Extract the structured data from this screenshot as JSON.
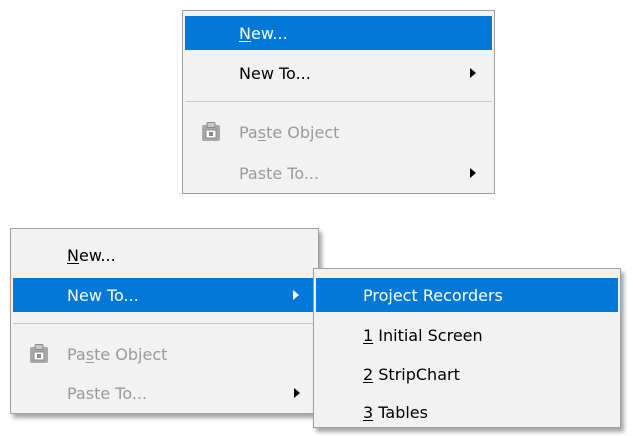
{
  "top_menu": {
    "items": [
      {
        "pre": "",
        "ul": "N",
        "post": "ew..."
      },
      {
        "pre": "New To...",
        "ul": "",
        "post": ""
      },
      {
        "pre": "Pa",
        "ul": "s",
        "post": "te Object"
      },
      {
        "pre": "Paste To...",
        "ul": "",
        "post": ""
      }
    ],
    "icons": {
      "paste": "clipboard-icon"
    }
  },
  "bottom_menu": {
    "items": [
      {
        "pre": "",
        "ul": "N",
        "post": "ew..."
      },
      {
        "pre": "New To...",
        "ul": "",
        "post": ""
      },
      {
        "pre": "Pa",
        "ul": "s",
        "post": "te Object"
      },
      {
        "pre": "Paste To...",
        "ul": "",
        "post": ""
      }
    ]
  },
  "submenu": {
    "items": [
      {
        "pre": "Project Recorders",
        "ul": "",
        "post": ""
      },
      {
        "pre": "",
        "ul": "1",
        "post": " Initial Screen"
      },
      {
        "pre": "",
        "ul": "2",
        "post": " StripChart"
      },
      {
        "pre": "",
        "ul": "3",
        "post": " Tables"
      }
    ]
  },
  "colors": {
    "highlight": "#0078d7",
    "menu_bg": "#f2f2f2",
    "disabled_text": "#9a9a9a"
  }
}
